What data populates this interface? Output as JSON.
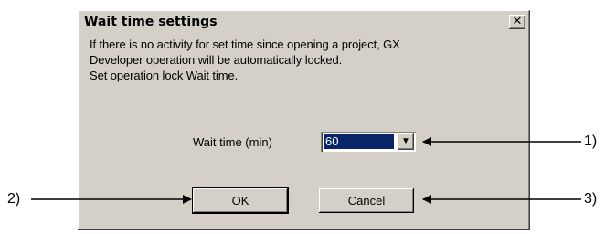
{
  "dialog": {
    "title": "Wait time settings",
    "close_label": "✕",
    "message_lines": [
      "If there is no activity for set time since opening a project, GX",
      "Developer operation will be automatically locked.",
      "Set operation lock Wait time."
    ],
    "wait_label": "Wait time (min)",
    "wait_value": "60",
    "ok_label": "OK",
    "cancel_label": "Cancel"
  },
  "callouts": {
    "c1": "1)",
    "c2": "2)",
    "c3": "3)"
  },
  "colors": {
    "dialog_bg": "#d4d0c8",
    "selection": "#0a246a"
  }
}
